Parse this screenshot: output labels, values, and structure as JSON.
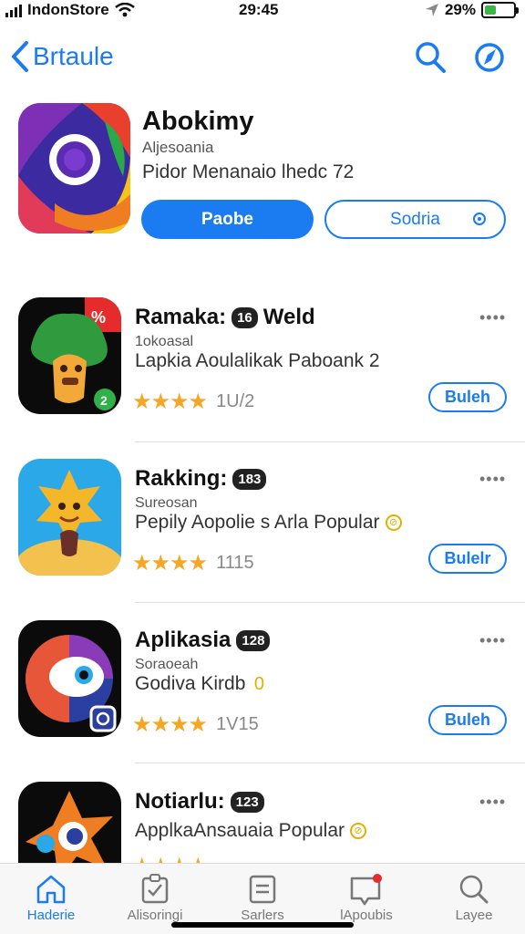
{
  "status": {
    "carrier": "IndonStore",
    "time": "29:45",
    "battery": "29%",
    "battery_color": "#3cb44a"
  },
  "nav": {
    "back_label": "Brtaule",
    "icons": [
      "search-icon",
      "compass-icon"
    ]
  },
  "featured": {
    "name": "Abokimy",
    "subtitle": "Aljesoania",
    "description": "Pidor Menanaio lhedc 72",
    "primary_button": "Paobe",
    "secondary_button": "Sodria"
  },
  "apps": [
    {
      "name": "Ramaka:",
      "badge": "16",
      "badge_suffix": "Weld",
      "subtitle": "1okoasal",
      "description": "Lapkia Aoulalikak Paboank 2",
      "rating_count": "1U/2",
      "button": "Buleh",
      "stars": 4
    },
    {
      "name": "Rakking:",
      "badge": "183",
      "badge_suffix": "",
      "subtitle": "Sureosan",
      "description": "Pepily Aopolie s Arla Popular",
      "rating_count": "1115",
      "button": "Bulelr",
      "stars": 4
    },
    {
      "name": "Aplikasia",
      "badge": "128",
      "badge_suffix": "",
      "subtitle": "Soraoeah",
      "description": "Godiva Kirdb",
      "rating_count": "1V15",
      "button": "Buleh",
      "stars": 4
    },
    {
      "name": "Notiarlu:",
      "badge": "123",
      "badge_suffix": "",
      "subtitle": "",
      "description": "ApplkaAnsauaia Popular",
      "rating_count": "",
      "button": "",
      "stars": 4
    }
  ],
  "tabs": [
    {
      "label": "Haderie",
      "icon": "home-icon",
      "active": true
    },
    {
      "label": "Alisoringi",
      "icon": "clipboard-icon",
      "active": false
    },
    {
      "label": "Sarlers",
      "icon": "list-icon",
      "active": false
    },
    {
      "label": "lApoubis",
      "icon": "inbox-icon",
      "active": false
    },
    {
      "label": "Layee",
      "icon": "search-icon",
      "active": false
    }
  ],
  "colors": {
    "accent": "#1a7cf0",
    "star": "#f5a623"
  }
}
